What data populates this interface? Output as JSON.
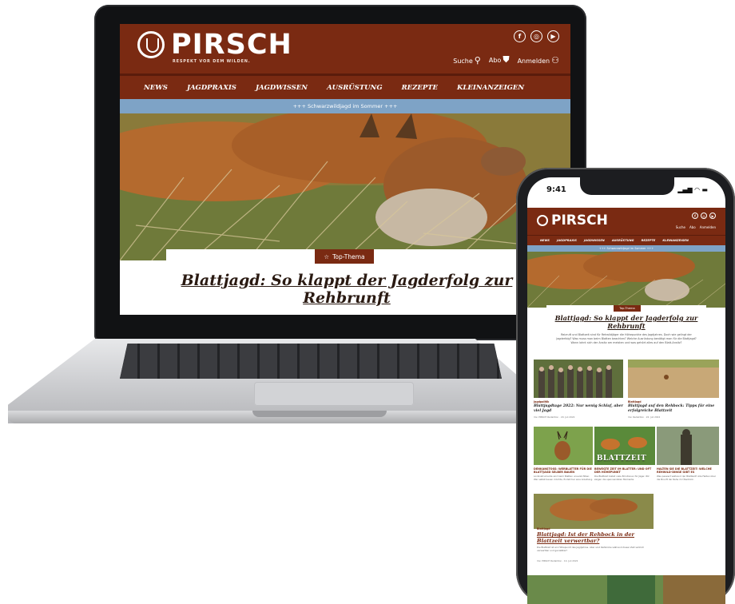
{
  "site": {
    "logo_text": "PIRSCH",
    "tagline": "RESPEKT VOR DEM WILDEN.",
    "utility": {
      "search": "Suche",
      "subscription": "Abo",
      "login": "Anmelden"
    },
    "social": [
      "f",
      "◎",
      "▶"
    ],
    "nav": [
      "NEWS",
      "JAGDPRAXIS",
      "JAGDWISSEN",
      "AUSRÜSTUNG",
      "REZEPTE",
      "KLEINANZEIGEN"
    ],
    "banner": "+++ Schwarzwildjagd im Sommer +++",
    "hero_badge": "Top-Thema",
    "hero_title": "Blattjagd: So klappt der Jagderfolg zur Rehbrunft"
  },
  "phone": {
    "time": "9:41",
    "signal": "▂▄▆ ◠ ▬",
    "hero_teaser": "Reizruft und Blattzeit sind für Rehwildjäger die Höhepunkte des Jagdjahres. Doch wie gelingt der Jagderfolg? Was muss man beim Blatten beachten? Welche Ausrüstung benötigt man für die Blattjagd? Wann lohnt sich der Ansitz am meisten und was gehört alles auf den Blatt-Ansitz?",
    "articles": [
      {
        "category": "Jagdpolitik",
        "title": "Blattjagdtage 2022: Nur wenig Schlaf, aber viel Jagd",
        "meta": "Von PIRSCH Redaktion · 29. Juli 2022"
      },
      {
        "category": "Blattjagd",
        "title": "Blattjagd auf den Rehbock: Tipps für eine erfolgreiche Blattzeit",
        "meta": "Von Redaktion · 22. Juli 2022"
      }
    ],
    "small_articles": [
      {
        "title": "DENKANSTOSS: WERBLATTER FÜR DIE BLATTJAGD SELBER BAUEN",
        "text": "Lockinstrumente sind beim Blatten unverzichtbar. Wer selbst bauen möchte, findet hier eine Anleitung."
      },
      {
        "title": "BEWEGTE ZEIT IM BLATTER: UND OFT DER HÖHEPUNKT",
        "text": "Die Blattzeit bietet viele Emotionen für Jäger. Wir zeigen die spannendsten Momente."
      },
      {
        "title": "HALTEN SIE DIE BLATTZEIT: WELCHE REHWILD-DINGE GIBT ES",
        "text": "Was passiert während der Blattzeit? Alle Fakten über die Brunft der Rehe im Überblick."
      }
    ],
    "blattzeit_label": "BLATTZEIT",
    "feature": {
      "category": "Blattjagd",
      "title": "Blattjagd: Ist der Rehbock in der Blattzeit verwertbar?",
      "text": "Die Blattzeit ist ein Höhepunkt des Jagdjahres. Aber sind Rehböcke während dieser Zeit wirklich verwertbar und genießbar?",
      "meta": "Von PIRSCH Redaktion · 14. Juli 2022"
    }
  },
  "colors": {
    "brand": "#7a2a12",
    "banner": "#7ea3c6",
    "text": "#2a1a12"
  },
  "icons": [
    "pirsch-logo-icon",
    "facebook-icon",
    "instagram-icon",
    "youtube-icon",
    "search-icon",
    "bag-icon",
    "user-icon",
    "star-icon"
  ]
}
